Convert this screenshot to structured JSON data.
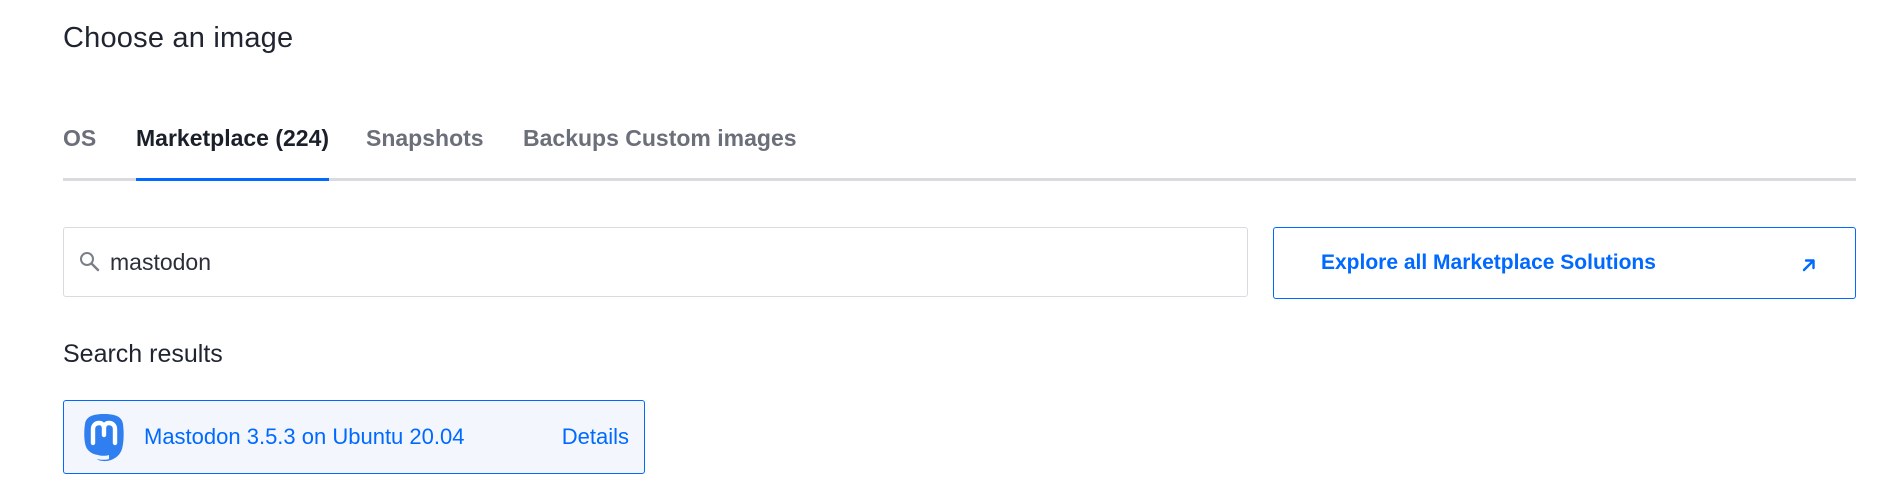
{
  "page": {
    "title": "Choose an image"
  },
  "tabs": [
    {
      "label": "OS",
      "active": false
    },
    {
      "label": "Marketplace (224)",
      "active": true
    },
    {
      "label": "Snapshots",
      "active": false
    },
    {
      "label": "Backups Custom images",
      "active": false
    }
  ],
  "search": {
    "value": "mastodon",
    "icon": "search-icon"
  },
  "explore": {
    "label": "Explore all Marketplace Solutions",
    "icon": "external-link-arrow-icon"
  },
  "results": {
    "heading": "Search results",
    "items": [
      {
        "name": "Mastodon 3.5.3 on Ubuntu 20.04",
        "details_label": "Details",
        "icon": "mastodon-icon"
      }
    ]
  },
  "colors": {
    "accent": "#0069ff",
    "tab_underline": "#d9dbe1",
    "card_bg": "#f3f7fd"
  }
}
